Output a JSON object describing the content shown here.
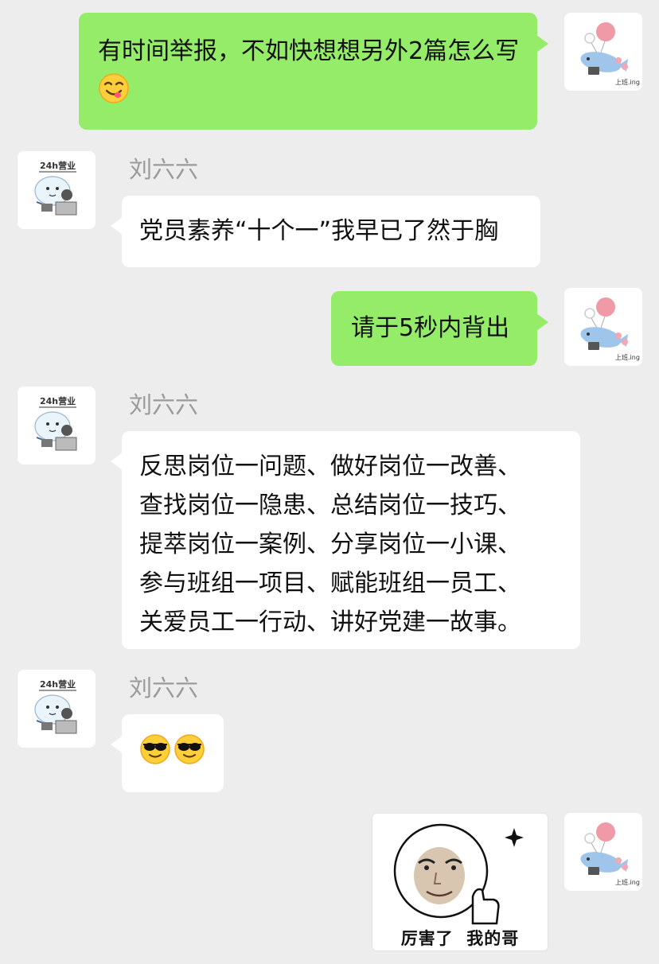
{
  "contact_name": "刘六六",
  "messages": [
    {
      "sender": "me",
      "text": "有时间举报，不如快想想另外2篇怎么写",
      "emoji": "yum-emoji"
    },
    {
      "sender": "刘六六",
      "text": "党员素养“十个一”我早已了然于胸"
    },
    {
      "sender": "me",
      "text": "请于5秒内背出"
    },
    {
      "sender": "刘六六",
      "lines": [
        "反思岗位一问题、做好岗位一改善、",
        "查找岗位一隐患、总结岗位一技巧、",
        "提萃岗位一案例、分享岗位一小课、",
        "参与班组一项目、赋能班组一员工、",
        "关爱员工一行动、讲好党建一故事。"
      ]
    },
    {
      "sender": "刘六六",
      "emojis": [
        "sunglasses-emoji",
        "sunglasses-emoji"
      ]
    },
    {
      "sender": "me",
      "sticker_caption": "厉害了  我的哥"
    }
  ],
  "avatars": {
    "me": {
      "caption": "上班.ing",
      "icon": "fish-balloon-avatar"
    },
    "them": {
      "caption": "24h营业",
      "icon": "bear-office-avatar"
    }
  },
  "colors": {
    "background": "#ededed",
    "my_bubble": "#95ec69",
    "their_bubble": "#ffffff",
    "name_text": "#9a9a9a"
  }
}
